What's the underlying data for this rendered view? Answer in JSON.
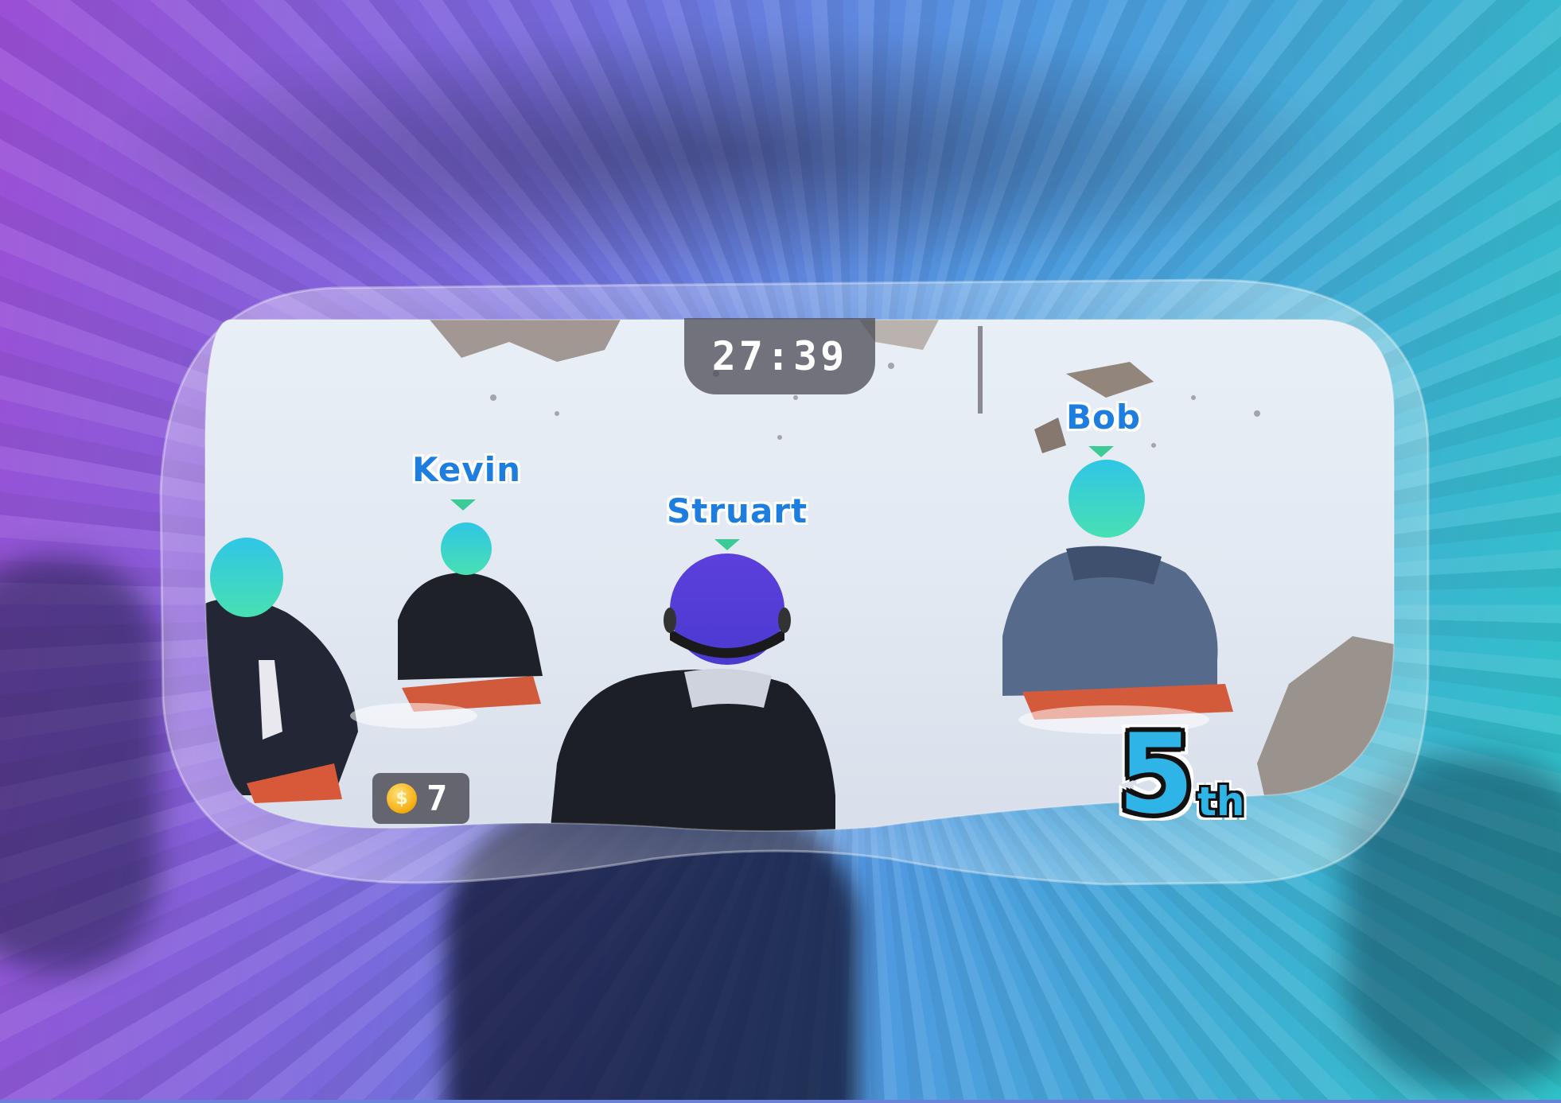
{
  "hud": {
    "timer": "27:39",
    "coins": "7",
    "position_number": "5",
    "position_suffix": "th"
  },
  "players": [
    {
      "name": "Kevin",
      "helmet_color": "#3bd0d8"
    },
    {
      "name": "Struart",
      "helmet_color": "#5a3fd6"
    },
    {
      "name": "Bob",
      "helmet_color": "#3bd0d8"
    }
  ],
  "icons": {
    "coin": "coin-icon",
    "marker": "player-marker-icon",
    "helmet": "helmet-icon"
  },
  "colors": {
    "label_text": "#1e7ee0",
    "marker": "#3ccb97",
    "rank_fill": "#2fb4e8",
    "player_helmet": "#5a3fd6",
    "opponent_helmet": "#3bd0d8"
  }
}
